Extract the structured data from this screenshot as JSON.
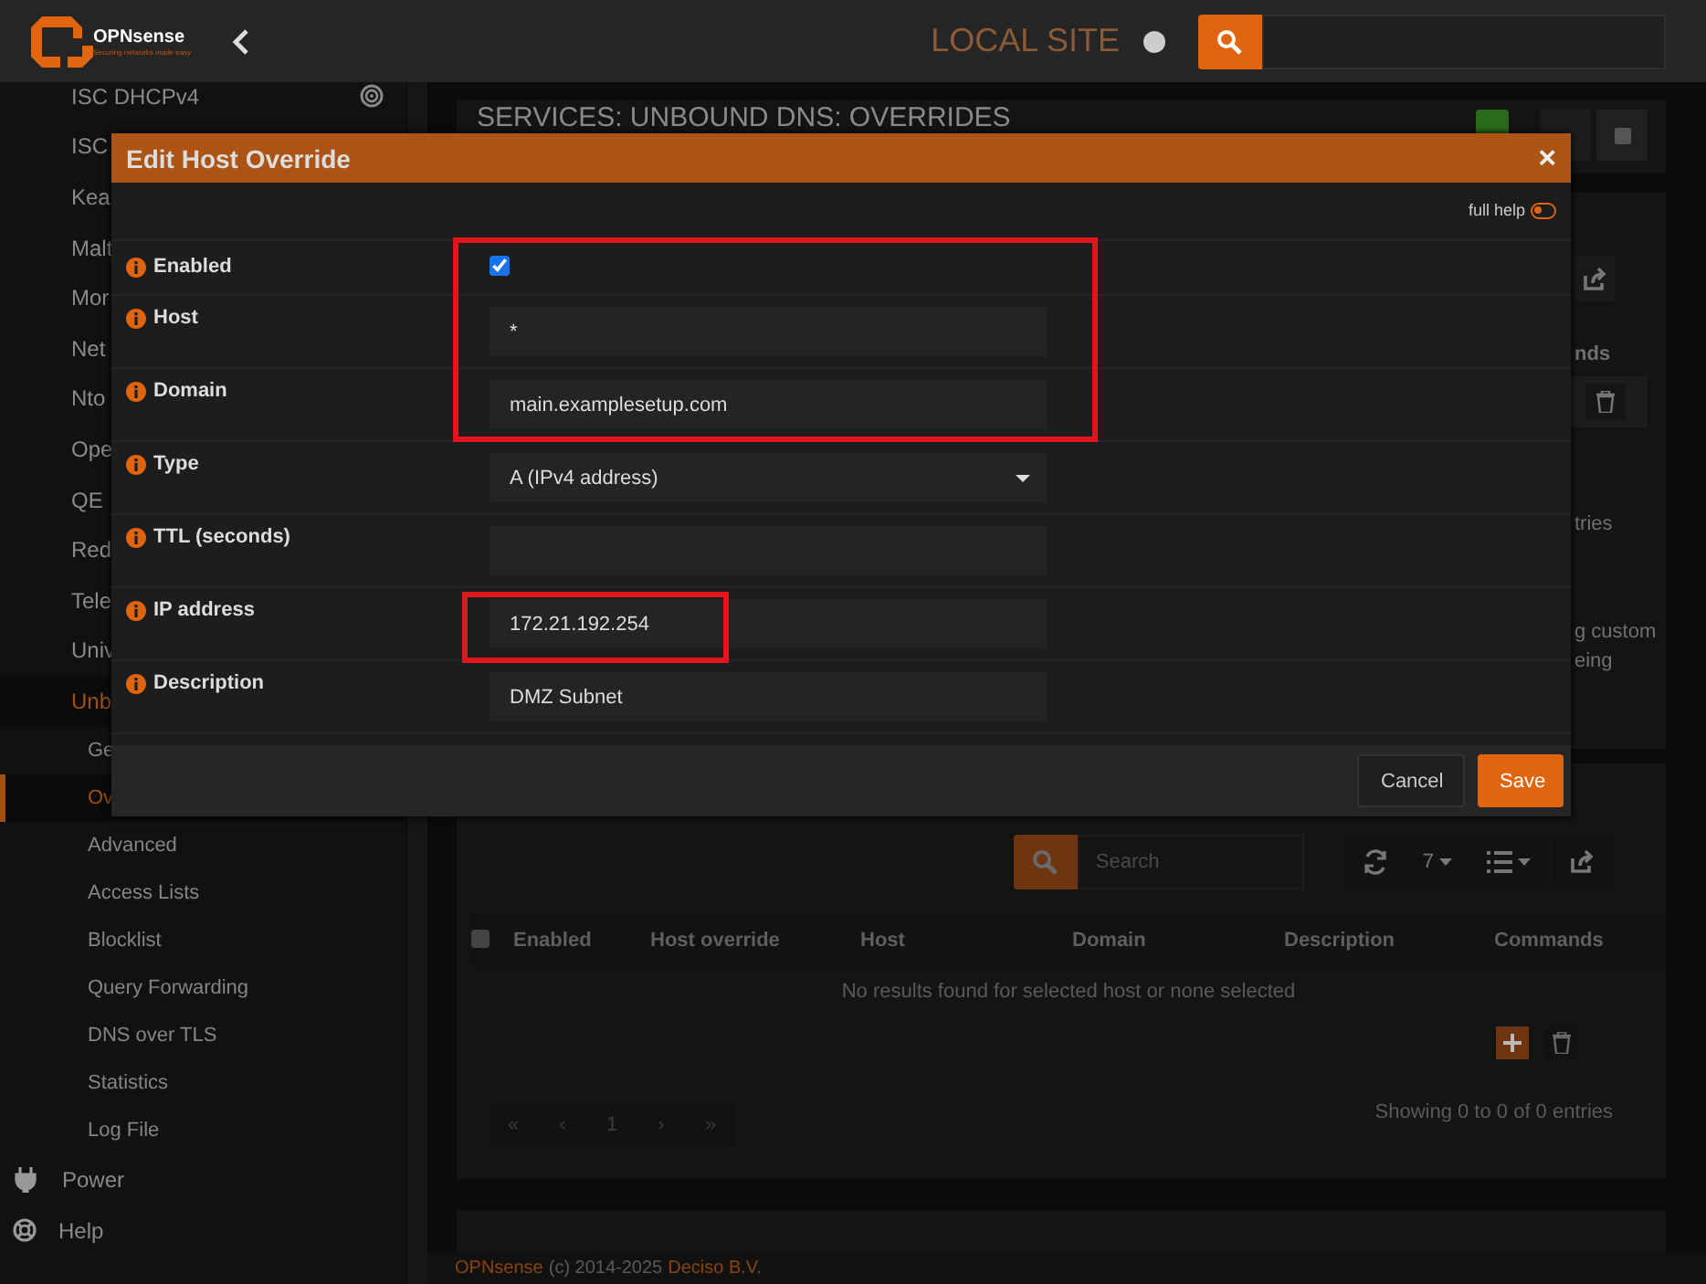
{
  "topbar": {
    "brand": "OPNsense",
    "tagline": "Securing networks made easy",
    "site": "LOCAL SITE"
  },
  "sidebar": {
    "items": [
      {
        "label": "ISC DHCPv4",
        "kind": "service",
        "selected": false
      },
      {
        "label": "ISC",
        "kind": "item",
        "selected": false
      },
      {
        "label": "Kea",
        "kind": "item",
        "selected": false
      },
      {
        "label": "Malt",
        "kind": "item",
        "selected": false
      },
      {
        "label": "Mor",
        "kind": "item",
        "selected": false
      },
      {
        "label": "Net",
        "kind": "item",
        "selected": false
      },
      {
        "label": "Nto",
        "kind": "item",
        "selected": false
      },
      {
        "label": "Ope",
        "kind": "item",
        "selected": false
      },
      {
        "label": "QE",
        "kind": "item",
        "selected": false
      },
      {
        "label": "Red",
        "kind": "item",
        "selected": false
      },
      {
        "label": "Tele",
        "kind": "item",
        "selected": false
      },
      {
        "label": "Univ",
        "kind": "item",
        "selected": false
      },
      {
        "label": "Unb",
        "kind": "item",
        "selected": true
      },
      {
        "label": "Ge",
        "kind": "sub",
        "selected": false
      },
      {
        "label": "Ov",
        "kind": "sub",
        "selected": true
      },
      {
        "label": "Advanced",
        "kind": "sub",
        "selected": false
      },
      {
        "label": "Access Lists",
        "kind": "sub",
        "selected": false
      },
      {
        "label": "Blocklist",
        "kind": "sub",
        "selected": false
      },
      {
        "label": "Query Forwarding",
        "kind": "sub",
        "selected": false
      },
      {
        "label": "DNS over TLS",
        "kind": "sub",
        "selected": false
      },
      {
        "label": "Statistics",
        "kind": "sub",
        "selected": false
      },
      {
        "label": "Log File",
        "kind": "sub",
        "selected": false
      },
      {
        "label": "Power",
        "kind": "power",
        "selected": false
      },
      {
        "label": "Help",
        "kind": "help",
        "selected": false
      }
    ]
  },
  "page_title": "SERVICES: UNBOUND DNS: OVERRIDES",
  "background_fragments": [
    "nds",
    "tries",
    "g custom",
    "eing"
  ],
  "grid": {
    "select_all_checked": false,
    "search_placeholder": "Search",
    "page_size": "7",
    "columns": [
      "Enabled",
      "Host override",
      "Host",
      "Domain",
      "Description",
      "Commands"
    ],
    "empty_message": "No results found for selected host or none selected",
    "pages": [
      "«",
      "‹",
      "1",
      "›",
      "»"
    ],
    "summary": "Showing 0 to 0 of 0 entries"
  },
  "footer": {
    "brand": "OPNsense",
    "copyright": "(c) 2014-2025",
    "company": "Deciso B.V."
  },
  "modal": {
    "title": "Edit Host Override",
    "close": "×",
    "full_help": "full help",
    "full_help_on": false,
    "fields": [
      {
        "label": "Enabled",
        "kind": "checkbox",
        "checked": true,
        "highlighted": true
      },
      {
        "label": "Host",
        "kind": "text",
        "value": "*",
        "highlighted": true
      },
      {
        "label": "Domain",
        "kind": "text",
        "value": "main.examplesetup.com",
        "highlighted": true
      },
      {
        "label": "Type",
        "kind": "select",
        "value": "A (IPv4 address)"
      },
      {
        "label": "TTL (seconds)",
        "kind": "text"
      },
      {
        "label": "IP address",
        "kind": "text",
        "value": "172.21.192.254",
        "value_highlighted": true
      },
      {
        "label": "Description",
        "kind": "text",
        "value": "DMZ Subnet"
      }
    ],
    "buttons": [
      {
        "label": "Cancel",
        "kind": "secondary"
      },
      {
        "label": "Save",
        "kind": "primary"
      }
    ]
  }
}
